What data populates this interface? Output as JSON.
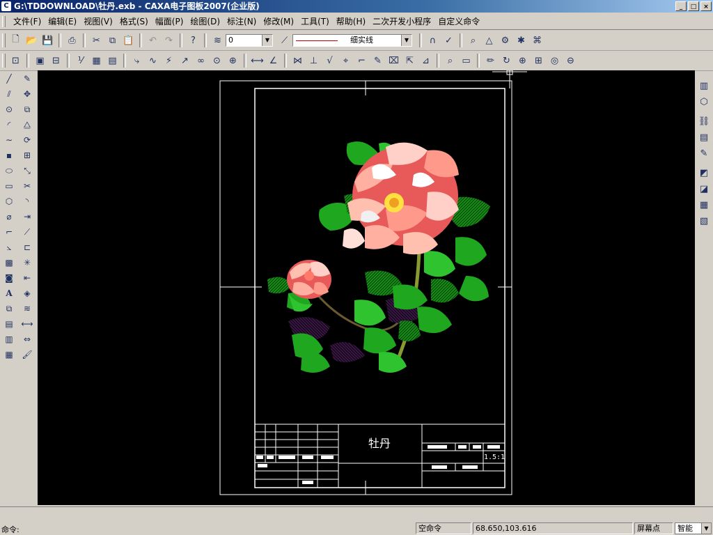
{
  "window": {
    "title": "G:\\TDDOWNLOAD\\牡丹.exb - CAXA电子图板2007(企业版)",
    "buttons": {
      "minimize": "_",
      "maximize": "□",
      "close": "×"
    }
  },
  "menu": [
    "文件(F)",
    "编辑(E)",
    "视图(V)",
    "格式(S)",
    "幅面(P)",
    "绘图(D)",
    "标注(N)",
    "修改(M)",
    "工具(T)",
    "帮助(H)",
    "二次开发小程序",
    "自定义命令"
  ],
  "toolbar": {
    "layer_value": "0",
    "linetype_value": "细实线",
    "dropdown_arrow": "▼"
  },
  "drawing": {
    "title_block_name": "牡丹",
    "scale": "1.5:1",
    "flower_colors": {
      "petal": "#ff9a8a",
      "petal_light": "#ffd0c8",
      "leaf": "#1fa81f",
      "leaf_dark": "#4a1a5a",
      "stem": "#8a9a30",
      "center": "#ffe040"
    }
  },
  "status": {
    "command_label": "命令:",
    "current_command": "空命令",
    "coordinates": "68.650,103.616",
    "snap_label": "屏幕点",
    "snap_mode": "智能"
  },
  "colors": {
    "titlebar_start": "#0a246a",
    "canvas": "#000000",
    "frame": "#ffffff"
  }
}
